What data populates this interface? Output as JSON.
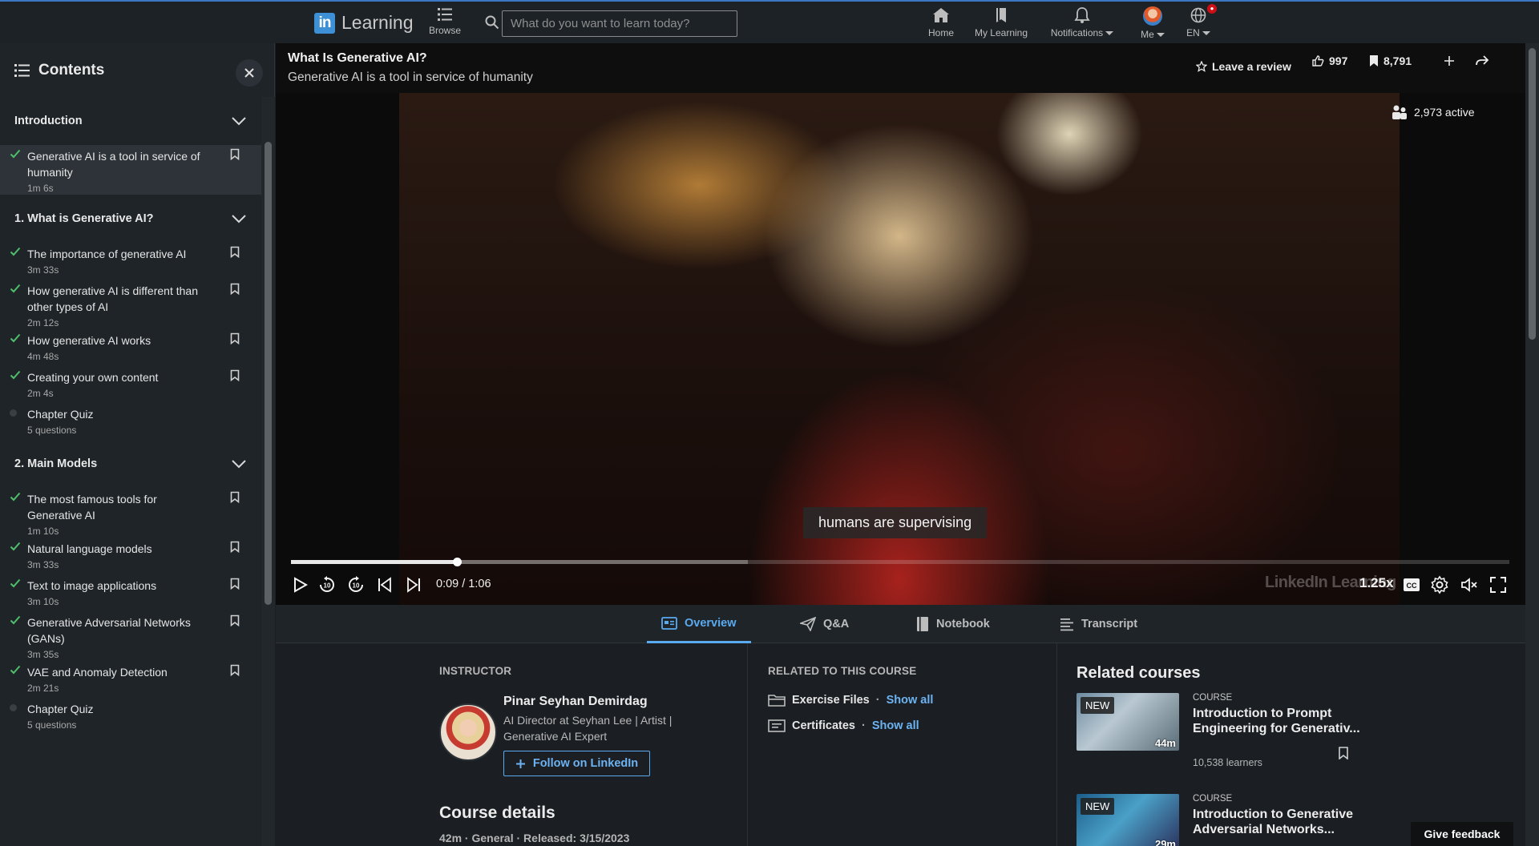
{
  "nav": {
    "logo_mark": "in",
    "logo_text": "Learning",
    "browse_label": "Browse",
    "search_placeholder": "What do you want to learn today?",
    "home_label": "Home",
    "mylearning_label": "My Learning",
    "notifications_label": "Notifications",
    "me_label": "Me",
    "lang_label": "EN",
    "icons": [
      "grid-list-icon",
      "search-icon",
      "home-icon",
      "bookmark-book-icon",
      "bell-icon",
      "avatar",
      "globe-icon"
    ]
  },
  "sidebar": {
    "title": "Contents",
    "sections": [
      {
        "title": "Introduction",
        "lessons": [
          {
            "title": "Generative AI is a tool in service of humanity",
            "duration": "1m 6s",
            "done": true,
            "active": true
          }
        ]
      },
      {
        "title": "1. What is Generative AI?",
        "lessons": [
          {
            "title": "The importance of generative AI",
            "duration": "3m 33s",
            "done": true
          },
          {
            "title": "How generative AI is different than other types of AI",
            "duration": "2m 12s",
            "done": true
          },
          {
            "title": "How generative AI works",
            "duration": "4m 48s",
            "done": true
          },
          {
            "title": "Creating your own content",
            "duration": "2m 4s",
            "done": true
          },
          {
            "title": "Chapter Quiz",
            "duration": "5 questions",
            "done": false,
            "quiz": true
          }
        ]
      },
      {
        "title": "2. Main Models",
        "lessons": [
          {
            "title": "The most famous tools for Generative AI",
            "duration": "1m 10s",
            "done": true
          },
          {
            "title": "Natural language models",
            "duration": "3m 33s",
            "done": true
          },
          {
            "title": "Text to image applications",
            "duration": "3m 10s",
            "done": true
          },
          {
            "title": "Generative Adversarial Networks (GANs)",
            "duration": "3m 35s",
            "done": true
          },
          {
            "title": "VAE and Anomaly Detection",
            "duration": "2m 21s",
            "done": true
          },
          {
            "title": "Chapter Quiz",
            "duration": "5 questions",
            "done": false,
            "quiz": true
          }
        ]
      }
    ]
  },
  "video": {
    "course_title": "What Is Generative AI?",
    "lesson_title": "Generative AI is a tool in service of humanity",
    "review_label": "Leave a review",
    "likes": "997",
    "saves": "8,791",
    "active_viewers": "2,973 active",
    "caption": "humans are supervising",
    "current_time": "0:09",
    "total_time": "1:06",
    "time_display": "0:09 / 1:06",
    "progress_fraction": 0.136,
    "buffer_fraction": 0.375,
    "watermark": "LinkedIn Learning",
    "speed": "1.25x"
  },
  "tabs": [
    {
      "label": "Overview",
      "icon": "overview-icon",
      "active": true
    },
    {
      "label": "Q&A",
      "icon": "paper-plane-icon",
      "active": false
    },
    {
      "label": "Notebook",
      "icon": "notebook-icon",
      "active": false
    },
    {
      "label": "Transcript",
      "icon": "transcript-icon",
      "active": false
    }
  ],
  "overview": {
    "instructor_heading": "INSTRUCTOR",
    "instructor_name": "Pinar Seyhan Demirdag",
    "instructor_role": "AI Director at Seyhan Lee | Artist | Generative AI Expert",
    "follow_label": "Follow on LinkedIn",
    "related_heading": "RELATED TO THIS COURSE",
    "related_items": [
      {
        "label": "Exercise Files",
        "link": "Show all",
        "icon": "folder-icon"
      },
      {
        "label": "Certificates",
        "link": "Show all",
        "icon": "certificate-icon"
      }
    ],
    "details_title": "Course details",
    "details_meta": "42m · General · Released: 3/15/2023"
  },
  "related_courses": {
    "title": "Related courses",
    "items": [
      {
        "kind": "COURSE",
        "title": "Introduction to Prompt Engineering for Generativ...",
        "learners": "10,538 learners",
        "badge": "NEW",
        "duration": "44m"
      },
      {
        "kind": "COURSE",
        "title": "Introduction to Generative Adversarial Networks...",
        "learners": "",
        "badge": "NEW",
        "duration": "29m"
      }
    ]
  },
  "feedback_label": "Give feedback",
  "colors": {
    "accent": "#5aaaf0",
    "check": "#4fbf6b",
    "notification_badge": "#cc1016"
  }
}
